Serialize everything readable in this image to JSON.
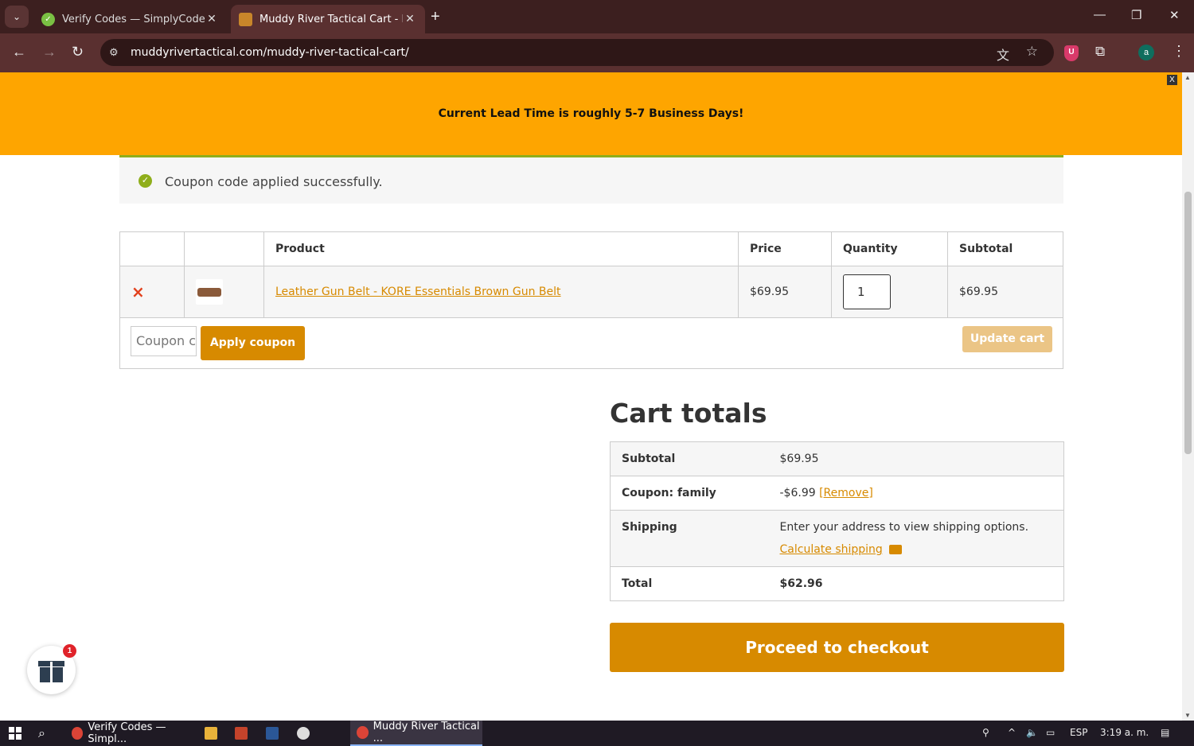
{
  "browser": {
    "tabs": [
      {
        "title": "Verify Codes — SimplyCodes",
        "active": false
      },
      {
        "title": "Muddy River Tactical Cart - Mud",
        "active": true
      }
    ],
    "url": "muddyrivertactical.com/muddy-river-tactical-cart/",
    "profile_initial": "a",
    "extension_badge": "U"
  },
  "banner": {
    "text": "Current Lead Time is roughly 5-7 Business Days!",
    "close_label": "X"
  },
  "notice": {
    "message": "Coupon code applied successfully."
  },
  "cart": {
    "headers": {
      "remove": "",
      "thumbnail": "",
      "product": "Product",
      "price": "Price",
      "quantity": "Quantity",
      "subtotal": "Subtotal"
    },
    "items": [
      {
        "remove": "×",
        "product": "Leather Gun Belt - KORE Essentials Brown Gun Belt",
        "price": "$69.95",
        "quantity": "1",
        "subtotal": "$69.95"
      }
    ],
    "coupon_placeholder": "Coupon code",
    "apply_label": "Apply coupon",
    "update_label": "Update cart"
  },
  "totals": {
    "title": "Cart totals",
    "subtotal_label": "Subtotal",
    "subtotal_value": "$69.95",
    "coupon_label": "Coupon: family",
    "coupon_value": "-$6.99",
    "coupon_remove": "[Remove]",
    "shipping_label": "Shipping",
    "shipping_text": "Enter your address to view shipping options.",
    "shipping_link": "Calculate shipping",
    "total_label": "Total",
    "total_value": "$62.96",
    "checkout_label": "Proceed to checkout"
  },
  "gift_widget": {
    "badge_count": "1"
  },
  "taskbar": {
    "apps": [
      {
        "label": "Verify Codes — Simpl..."
      },
      {
        "label": "Muddy River Tactical ..."
      }
    ],
    "language": "ESP",
    "time": "3:19 a. m."
  },
  "colors": {
    "accent": "#d78a00",
    "banner": "#fea500",
    "success": "#8fae1b",
    "remove": "#e2401c"
  }
}
